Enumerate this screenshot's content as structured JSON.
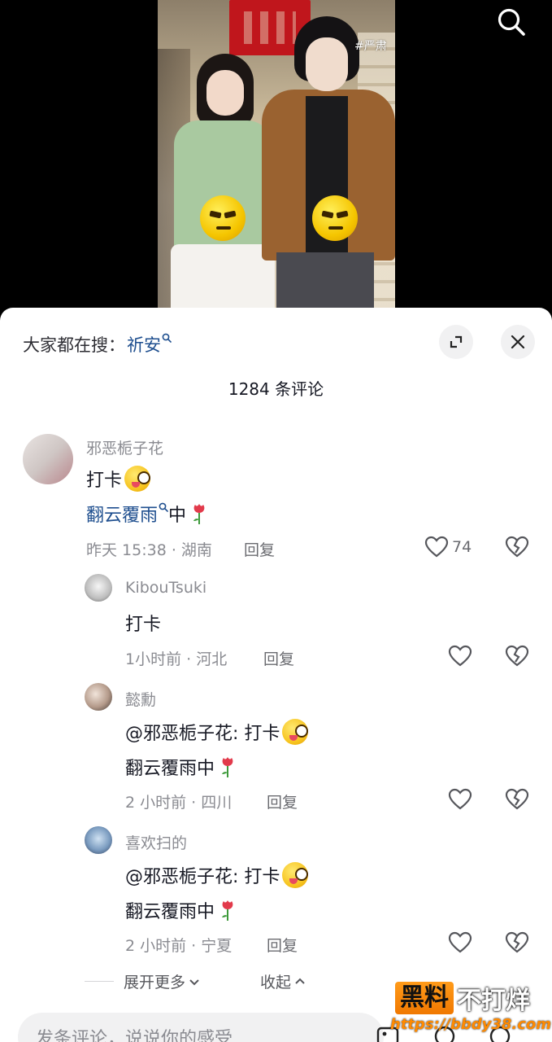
{
  "video": {
    "hashtag": "#严肃"
  },
  "sheet": {
    "hot_search_prefix": "大家都在搜：",
    "hot_search_keyword": "祈安",
    "comment_count": "1284 条评论"
  },
  "comments": [
    {
      "author": "邪恶栀子花",
      "line1": "打卡",
      "line2_link": "翻云覆雨",
      "line2_rest": "中",
      "time": "昨天 15:38 · 湖南",
      "reply": "回复",
      "likes": "74"
    }
  ],
  "replies": [
    {
      "author": "KibouTsuki",
      "line1": "打卡",
      "time": "1小时前 · 河北",
      "reply": "回复"
    },
    {
      "author": "懿勳",
      "line1": "@邪恶栀子花: 打卡",
      "line2": "翻云覆雨中",
      "time": "2 小时前 · 四川",
      "reply": "回复"
    },
    {
      "author": "喜欢扫的",
      "line1": "@邪恶栀子花: 打卡",
      "line2": "翻云覆雨中",
      "time": "2 小时前 · 宁夏",
      "reply": "回复"
    }
  ],
  "thread_controls": {
    "expand_more": "展开更多",
    "collapse": "收起"
  },
  "input": {
    "placeholder": "发条评论，说说你的感受"
  },
  "watermark": {
    "badge": "黑料",
    "text": "不打烊",
    "url": "https://bbdy38.com"
  },
  "icons": [
    "search-icon",
    "expand-icon",
    "close-icon",
    "heart-icon",
    "broken-heart-icon",
    "chevron-down-icon",
    "chevron-up-icon",
    "rose-icon"
  ]
}
